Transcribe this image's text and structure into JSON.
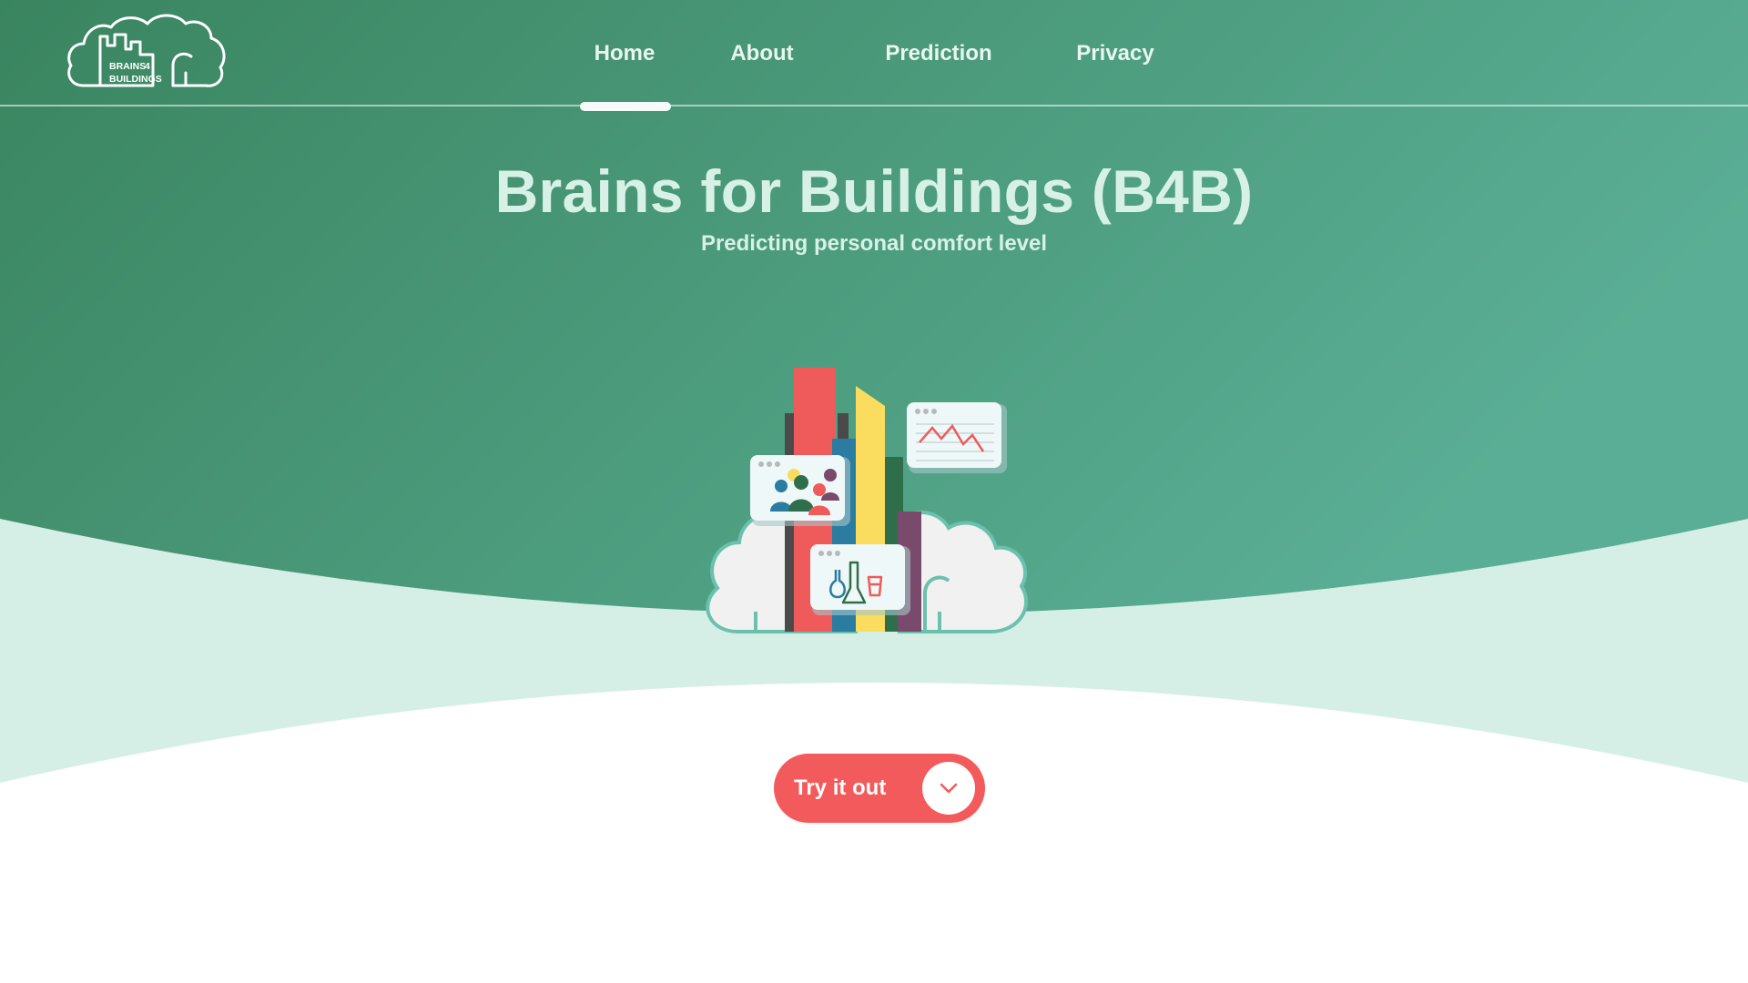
{
  "brand": {
    "logo_line1": "BRAINS",
    "logo_digit": "4",
    "logo_line2": "BUILDINGS",
    "logo_icon": "brain-city-logo"
  },
  "nav": {
    "items": [
      {
        "label": "Home",
        "active": true
      },
      {
        "label": "About",
        "active": false
      },
      {
        "label": "Prediction",
        "active": false
      },
      {
        "label": "Privacy",
        "active": false
      }
    ]
  },
  "hero": {
    "title": "Brains for Buildings (B4B)",
    "subtitle": "Predicting personal comfort level",
    "illustration": "brain-with-buildings-illustration"
  },
  "cta": {
    "label": "Try it out",
    "icon": "chevron-down-icon"
  },
  "colors": {
    "header_green_start": "#3a8560",
    "header_green_end": "#5aae95",
    "mint_band": "#d6efe6",
    "accent_red": "#f35a5c",
    "title_text": "#d7f1e6"
  }
}
